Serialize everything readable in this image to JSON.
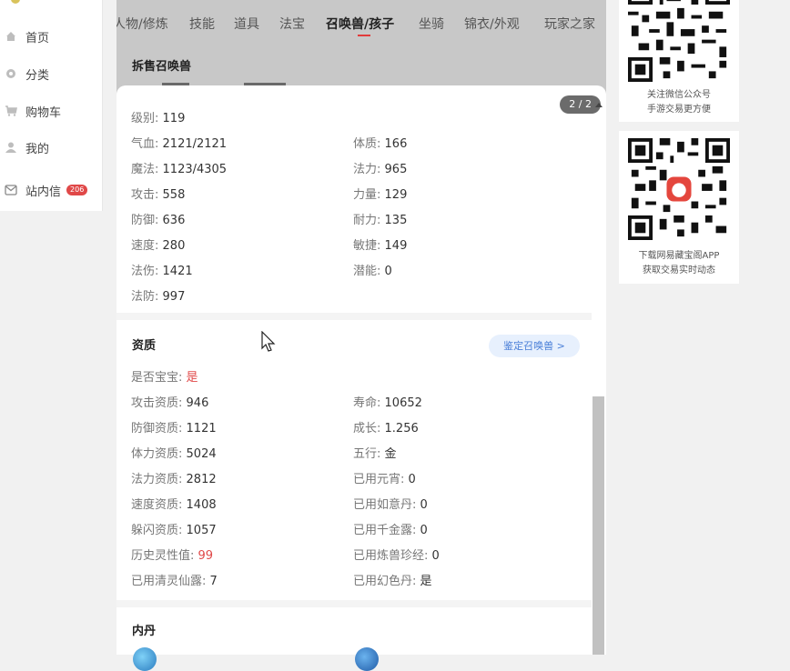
{
  "sidebar": {
    "items": [
      {
        "label": "首页",
        "icon": "home-icon"
      },
      {
        "label": "分类",
        "icon": "category-icon"
      },
      {
        "label": "购物车",
        "icon": "cart-icon"
      },
      {
        "label": "我的",
        "icon": "user-icon"
      },
      {
        "label": "站内信",
        "icon": "mail-icon",
        "badge": "206"
      }
    ]
  },
  "tabs": [
    "人物/修炼",
    "技能",
    "道具",
    "法宝",
    "召唤兽/孩子",
    "坐骑",
    "锦衣/外观",
    "玩家之家"
  ],
  "active_tab": "召唤兽/孩子",
  "section_top_title": "拆售召唤兽",
  "pager": "2 / 2",
  "stats": {
    "level": {
      "label": "级别:",
      "value": "119"
    },
    "left": [
      {
        "label": "气血:",
        "value": "2121/2121"
      },
      {
        "label": "魔法:",
        "value": "1123/4305"
      },
      {
        "label": "攻击:",
        "value": "558"
      },
      {
        "label": "防御:",
        "value": "636"
      },
      {
        "label": "速度:",
        "value": "280"
      },
      {
        "label": "法伤:",
        "value": "1421"
      },
      {
        "label": "法防:",
        "value": "997"
      }
    ],
    "right": [
      {
        "label": "体质:",
        "value": "166"
      },
      {
        "label": "法力:",
        "value": "965"
      },
      {
        "label": "力量:",
        "value": "129"
      },
      {
        "label": "耐力:",
        "value": "135"
      },
      {
        "label": "敏捷:",
        "value": "149"
      },
      {
        "label": "潜能:",
        "value": "0"
      }
    ]
  },
  "aptitude": {
    "title": "资质",
    "identify_button": "鉴定召唤兽 >",
    "is_baby": {
      "label": "是否宝宝:",
      "value": "是"
    },
    "left": [
      {
        "label": "攻击资质:",
        "value": "946"
      },
      {
        "label": "防御资质:",
        "value": "1121"
      },
      {
        "label": "体力资质:",
        "value": "5024"
      },
      {
        "label": "法力资质:",
        "value": "2812"
      },
      {
        "label": "速度资质:",
        "value": "1408"
      },
      {
        "label": "躲闪资质:",
        "value": "1057"
      },
      {
        "label": "历史灵性值:",
        "value": "99"
      },
      {
        "label": "已用清灵仙露:",
        "value": "7"
      }
    ],
    "right": [
      {
        "label": "寿命:",
        "value": "10652"
      },
      {
        "label": "成长:",
        "value": "1.256"
      },
      {
        "label": "五行:",
        "value": "金"
      },
      {
        "label": "已用元宵:",
        "value": "0"
      },
      {
        "label": "已用如意丹:",
        "value": "0"
      },
      {
        "label": "已用千金露:",
        "value": "0"
      },
      {
        "label": "已用炼兽珍经:",
        "value": "0"
      },
      {
        "label": "已用幻色丹:",
        "value": "是"
      }
    ]
  },
  "neidan": {
    "title": "内丹"
  },
  "right_column": {
    "qr1_caption_line1": "关注微信公众号",
    "qr1_caption_line2": "手游交易更方便",
    "qr2_caption_line1": "下载网易藏宝阁APP",
    "qr2_caption_line2": "获取交易实时动态"
  },
  "colors": {
    "accent_red": "#e04848",
    "identify_blue": "#4a7fd8",
    "tab_underline": "#e23b3b"
  }
}
